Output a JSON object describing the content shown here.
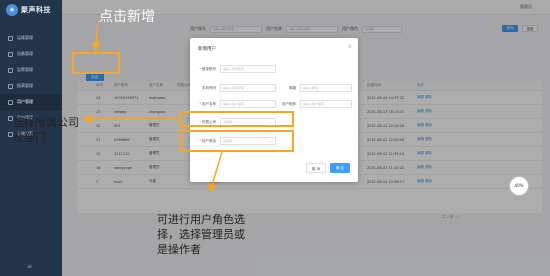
{
  "brand": {
    "name": "聚声科技"
  },
  "topbar": {
    "user": "管理员"
  },
  "sidebar": {
    "items": [
      {
        "label": "运维管理"
      },
      {
        "label": "设备管理"
      },
      {
        "label": "告警管理"
      },
      {
        "label": "报表管理"
      },
      {
        "label": "用户管理"
      },
      {
        "label": "用户管理"
      },
      {
        "label": "系统设置"
      }
    ]
  },
  "filters": {
    "username_label": "用户账号",
    "username_placeholder": "请输入用户账号",
    "name_label": "用户名称",
    "name_placeholder": "请输入用户名称",
    "role_label": "用户角色",
    "role_placeholder": "请选择",
    "search_label": "查询",
    "reset_label": "重置"
  },
  "add_button": "新增",
  "table": {
    "headers": [
      "",
      "序号",
      "用户账号",
      "用户名称",
      "所属公司",
      "所属部门",
      "用户角色",
      "状态",
      "手机号码",
      "创建时间",
      "操作"
    ],
    "rows": [
      [
        "",
        "24",
        "19316158971",
        "linghaibo",
        "",
        "",
        "",
        "",
        "",
        "2021-08-15 14:37:22",
        "编辑 删除"
      ],
      [
        "",
        "23",
        "rdeqdq",
        "zhangsan",
        "",
        "",
        "",
        "",
        "",
        "2021-08-13 18:13:15",
        "编辑 删除"
      ],
      [
        "",
        "22",
        "001",
        "管理员",
        "",
        "",
        "",
        "",
        "",
        "2021-08-12 10:15:26",
        "编辑 删除"
      ],
      [
        "",
        "21",
        "5566666",
        "管理员",
        "",
        "",
        "",
        "",
        "",
        "2021-08-02 12:05:06",
        "编辑 删除"
      ],
      [
        "",
        "15",
        "1111110",
        "管理员",
        "",
        "",
        "",
        "",
        "",
        "2021-08-02 11:35:14",
        "编辑 删除"
      ],
      [
        "",
        "16",
        "wangyuge",
        "管理员",
        "",
        "",
        "",
        "",
        "",
        "2021-08-02 11:20:22",
        "编辑 删除"
      ],
      [
        "",
        "7",
        "maci",
        "马春",
        "",
        "管理员",
        "",
        "",
        "",
        "2021-06-10 13:38:27",
        "编辑 删除"
      ]
    ]
  },
  "pagination": {
    "total": "共 7 条",
    "page": "1"
  },
  "dialog": {
    "title": "新增用户",
    "close": "×",
    "fields": [
      {
        "label": "登录账号",
        "required": true,
        "placeholder": "请输入登录账号"
      },
      {
        "label": "手机号码",
        "required": false,
        "placeholder": "请输入手机号码"
      },
      {
        "label": "邮箱",
        "required": false,
        "placeholder": "请输入邮箱"
      },
      {
        "label": "用户名称",
        "required": true,
        "placeholder": "请输入用户名称"
      },
      {
        "label": "用户昵称",
        "required": false,
        "placeholder": "请输入用户昵称"
      },
      {
        "label": "所属公司",
        "required": true,
        "placeholder": "请选择"
      },
      {
        "label": "用户角色",
        "required": true,
        "placeholder": "请选择"
      }
    ],
    "cancel_label": "取 消",
    "confirm_label": "确 定"
  },
  "annotations": {
    "add_hint": "点击新增",
    "company_hint": "选择所属公司\n及部门",
    "role_hint": "可进行用户角色选\n择，选择管理员或\n是操作者",
    "color": "#f5a623"
  },
  "zoom_badge": "40%"
}
